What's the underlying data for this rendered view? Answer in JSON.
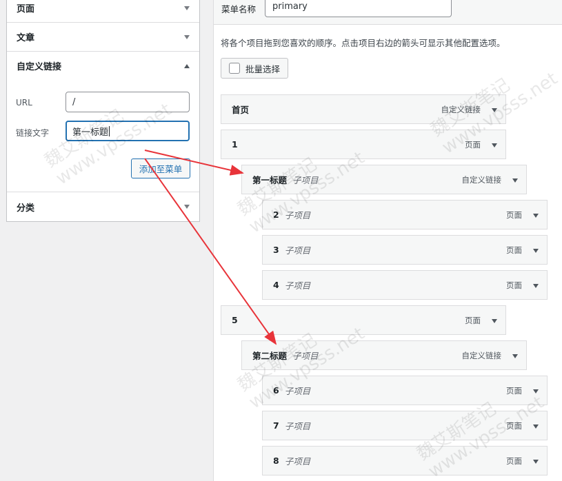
{
  "left_panel": {
    "sections": [
      {
        "label": "页面",
        "expanded": false
      },
      {
        "label": "文章",
        "expanded": false
      },
      {
        "label": "自定义链接",
        "expanded": true
      },
      {
        "label": "分类",
        "expanded": false
      }
    ],
    "custom_link": {
      "url_label": "URL",
      "url_value": "/",
      "text_label": "链接文字",
      "text_value": "第一标题",
      "add_button": "添加至菜单"
    }
  },
  "menu": {
    "name_label": "菜单名称",
    "name_value": "primary",
    "instructions": "将各个项目拖到您喜欢的顺序。点击项目右边的箭头可显示其他配置选项。",
    "bulk_select": "批量选择",
    "items": [
      {
        "title": "首页",
        "sub": "",
        "type": "自定义链接",
        "depth": 0
      },
      {
        "title": "1",
        "sub": "",
        "type": "页面",
        "depth": 0
      },
      {
        "title": "第一标题",
        "sub": "子项目",
        "type": "自定义链接",
        "depth": 1
      },
      {
        "title": "2",
        "sub": "子项目",
        "type": "页面",
        "depth": 2
      },
      {
        "title": "3",
        "sub": "子项目",
        "type": "页面",
        "depth": 2
      },
      {
        "title": "4",
        "sub": "子项目",
        "type": "页面",
        "depth": 2
      },
      {
        "title": "5",
        "sub": "",
        "type": "页面",
        "depth": 0
      },
      {
        "title": "第二标题",
        "sub": "子项目",
        "type": "自定义链接",
        "depth": 1
      },
      {
        "title": "6",
        "sub": "子项目",
        "type": "页面",
        "depth": 2
      },
      {
        "title": "7",
        "sub": "子项目",
        "type": "页面",
        "depth": 2
      },
      {
        "title": "8",
        "sub": "子项目",
        "type": "页面",
        "depth": 2
      }
    ]
  },
  "watermark": {
    "line1": "魏艾斯笔记",
    "line2": "www.vpsss.net"
  },
  "colors": {
    "accent": "#2271b1",
    "annotation_arrow": "#e8343a",
    "panel_border": "#c3c4c7"
  }
}
